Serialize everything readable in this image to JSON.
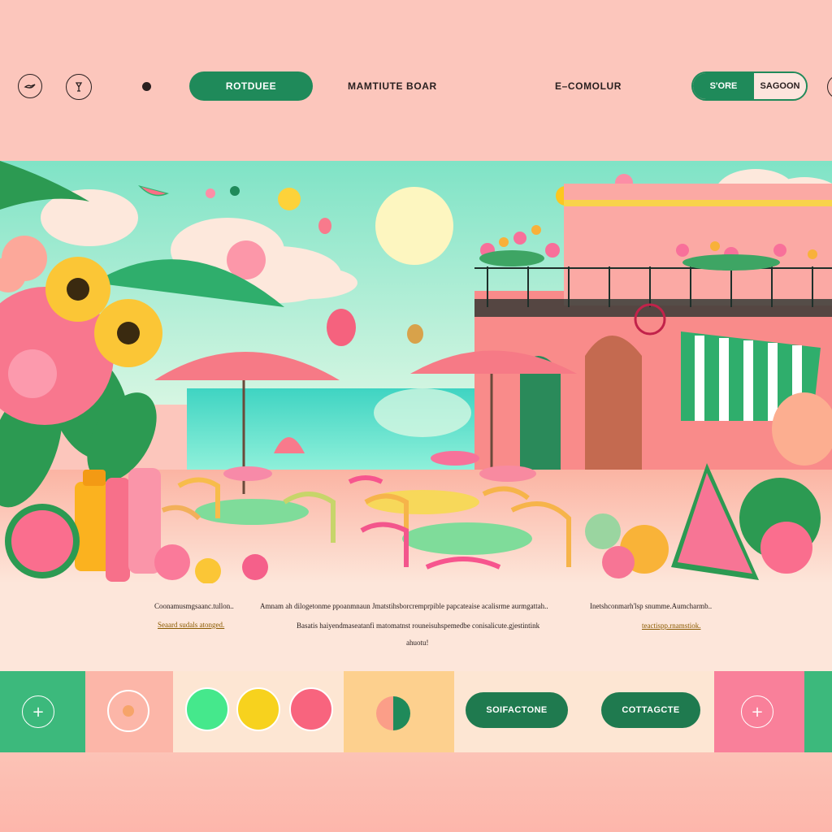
{
  "header": {
    "primary_button": "ROTDUEE",
    "nav_center": "MAMTIUTE BOAR",
    "nav_right": "E–COMOLUR",
    "split_left": "S'ORE",
    "split_right": "SAGOON"
  },
  "content": {
    "col1_line1": "Coonamusmgsaanc.tullon..",
    "col1_link": "Seaard sudals atonged.",
    "col2_line1": "Amnam ah dilogetonme ppoanmnaun Jmatstihsborcremprpible papcateaise acalisrme aurmgattah..",
    "col2_line2": "Basatis haiyendmaseatanfi matomatnst rouneisuhspemedbe conisalicute.gjestintink",
    "col2_line3": "ahuotu!",
    "col3_line1": "Inetshconmarh'lsp snumme.Aumcharmb..",
    "col3_link": "teactispp.rnamstiok."
  },
  "swatch_bar": {
    "button_1": "SOIFACTONE",
    "button_2": "COTTAGCTE",
    "colors": {
      "block_green": "#3cb97c",
      "block_pink": "#fcb6a8",
      "block_cream": "#fde6d3",
      "block_peach": "#fdd08e",
      "block_cream2": "#fde6d3",
      "block_hotpink": "#f9809a",
      "swatch_mint": "#45e88c",
      "swatch_yellow": "#f7d21e",
      "swatch_pink": "#f8647e"
    }
  },
  "icons": [
    "bird-icon",
    "cocktail-icon",
    "dot-icon",
    "plus-icon",
    "add-icon"
  ]
}
